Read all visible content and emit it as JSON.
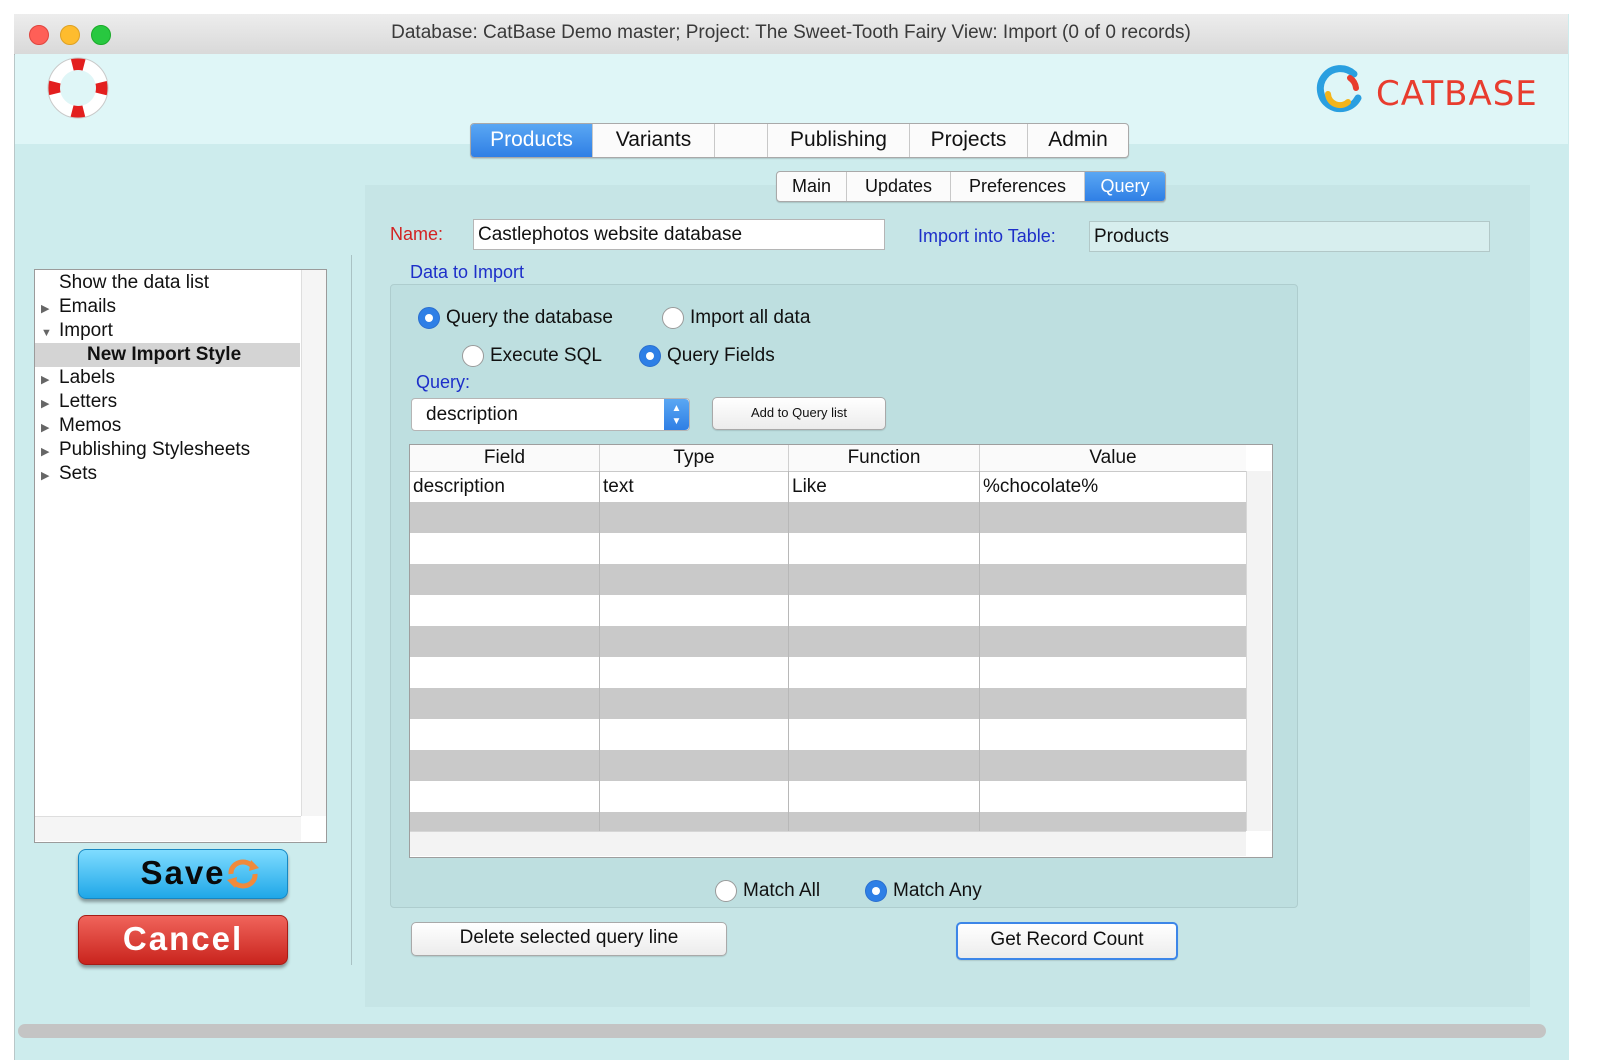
{
  "window": {
    "title": "Database: CatBase Demo master; Project: The Sweet-Tooth Fairy    View: Import (0 of 0 records)"
  },
  "logo": {
    "text": "CATBASE"
  },
  "main_tabs": [
    {
      "label": "Products",
      "active": true
    },
    {
      "label": "Variants",
      "active": false
    },
    {
      "label": "",
      "active": false
    },
    {
      "label": "Publishing",
      "active": false
    },
    {
      "label": "Projects",
      "active": false
    },
    {
      "label": "Admin",
      "active": false
    }
  ],
  "sub_tabs": [
    {
      "label": "Main",
      "active": false
    },
    {
      "label": "Updates",
      "active": false
    },
    {
      "label": "Preferences",
      "active": false
    },
    {
      "label": "Query",
      "active": true
    }
  ],
  "form": {
    "name_label": "Name:",
    "name_value": "Castlephotos website database",
    "import_into_label": "Import into Table:",
    "import_into_value": "Products",
    "data_to_import_label": "Data to Import",
    "query_label": "Query:",
    "query_select_value": "description",
    "add_to_query_label": "Add to Query list"
  },
  "radios": {
    "query_database": {
      "label": "Query the database",
      "selected": true
    },
    "import_all": {
      "label": "Import all data",
      "selected": false
    },
    "execute_sql": {
      "label": "Execute SQL",
      "selected": false
    },
    "query_fields": {
      "label": "Query Fields",
      "selected": true
    },
    "match_all": {
      "label": "Match All",
      "selected": false
    },
    "match_any": {
      "label": "Match Any",
      "selected": true
    }
  },
  "query_table": {
    "columns": [
      "Field",
      "Type",
      "Function",
      "Value"
    ],
    "rows": [
      [
        "description",
        "text",
        "Like",
        "%chocolate%"
      ]
    ]
  },
  "sidebar": {
    "items": [
      {
        "label": "Show the data list",
        "arrow": ""
      },
      {
        "label": "Emails",
        "arrow": "▶"
      },
      {
        "label": "Import",
        "arrow": "▼"
      },
      {
        "label": "New Import Style",
        "arrow": ""
      },
      {
        "label": "Labels",
        "arrow": "▶"
      },
      {
        "label": "Letters",
        "arrow": "▶"
      },
      {
        "label": "Memos",
        "arrow": "▶"
      },
      {
        "label": "Publishing Stylesheets",
        "arrow": "▶"
      },
      {
        "label": "Sets",
        "arrow": "▶"
      }
    ]
  },
  "buttons": {
    "save": "Save",
    "cancel": "Cancel",
    "delete_query_line": "Delete selected query line",
    "get_record_count": "Get Record Count"
  },
  "colors": {
    "accent_blue": "#2f7fe5",
    "label_blue": "#1d2fc9",
    "label_red": "#d32222",
    "save_blue": "#1fa7e8",
    "cancel_red": "#c9241d",
    "logo_red": "#e83c2e"
  }
}
